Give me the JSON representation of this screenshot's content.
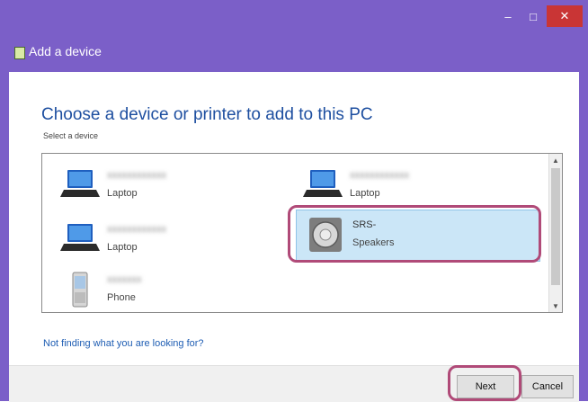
{
  "window": {
    "title": "Add a device",
    "controls": {
      "minimize": "–",
      "maximize": "□",
      "close": "✕"
    }
  },
  "main": {
    "heading": "Choose a device or printer to add to this PC",
    "subheading": "Select a device",
    "devices": [
      {
        "name": "",
        "type": "Laptop",
        "icon": "laptop-icon"
      },
      {
        "name": "",
        "type": "Laptop",
        "icon": "laptop-icon"
      },
      {
        "name": "",
        "type": "Laptop",
        "icon": "laptop-icon"
      },
      {
        "name": "SRS-",
        "type": "Speakers",
        "icon": "speaker-icon",
        "selected": true
      },
      {
        "name": "",
        "type": "Phone",
        "icon": "phone-icon"
      }
    ],
    "link": "Not finding what you are looking for?"
  },
  "footer": {
    "next": "Next",
    "cancel": "Cancel"
  },
  "colors": {
    "accent": "#7b5fc8",
    "highlight": "#b04a78",
    "selection": "#cbe6f7"
  }
}
